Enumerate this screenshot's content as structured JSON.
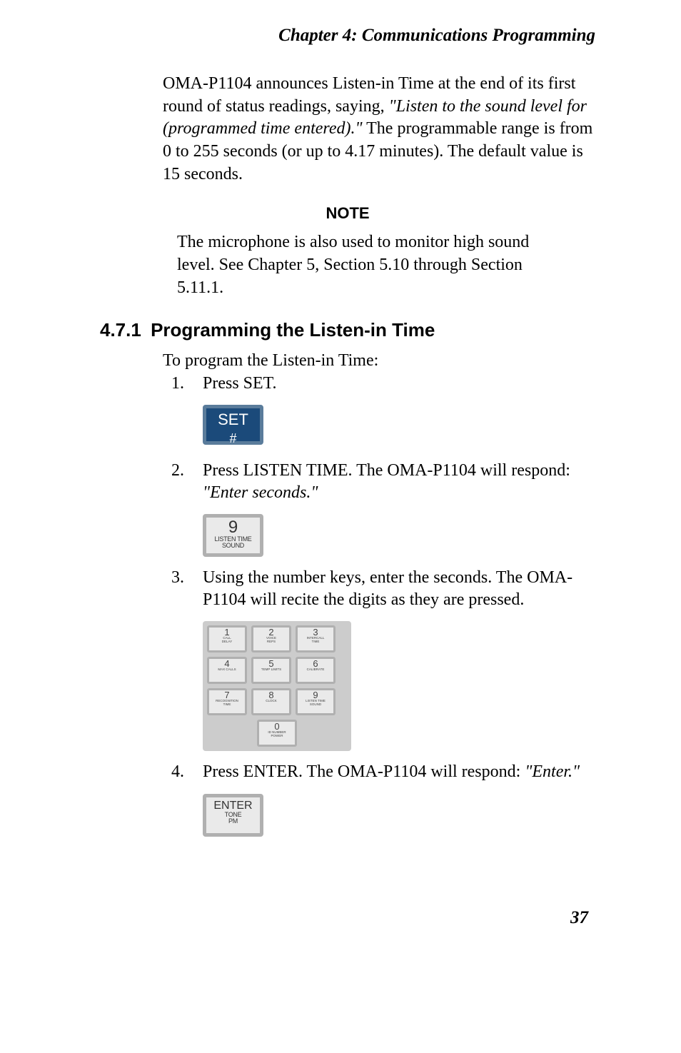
{
  "header": {
    "text": "Chapter 4: Communications Programming"
  },
  "intro_text": "OMA-P1104 announces Listen-in Time at the end of its first round of status readings, saying, ",
  "intro_quote": "\"Listen to the sound level for (programmed time entered).\"",
  "intro_rest": " The programmable range is from 0 to 255 seconds (or up to 4.17 minutes). The default value is 15 seconds.",
  "note": {
    "label": "NOTE",
    "text": "The microphone is also used to monitor high sound level. See Chapter 5, Section 5.10 through Section 5.11.1."
  },
  "section": {
    "num": "4.7.1",
    "title": "Programming the Listen-in Time"
  },
  "lead": "To program the Listen-in Time:",
  "steps": {
    "s1": {
      "text": "Press SET.",
      "key": {
        "line1": "SET",
        "line2": "#"
      }
    },
    "s2": {
      "text_before": "Press LISTEN TIME. The OMA-P1104 will respond: ",
      "quote": "\"Enter seconds.\"",
      "key": {
        "num": "9",
        "sub1": "LISTEN TIME",
        "sub2": "SOUND"
      }
    },
    "s3": {
      "text": "Using the number keys, enter the seconds. The OMA-P1104 will recite the digits as they are pressed.",
      "keypad": [
        {
          "n": "1",
          "s1": "CALL",
          "s2": "DELAY"
        },
        {
          "n": "2",
          "s1": "VOICE",
          "s2": "REPS"
        },
        {
          "n": "3",
          "s1": "INTERCALL",
          "s2": "TIME"
        },
        {
          "n": "4",
          "s1": "MAX CALLS",
          "s2": ""
        },
        {
          "n": "5",
          "s1": "TEMP LIMITS",
          "s2": ""
        },
        {
          "n": "6",
          "s1": "CALIBRATE",
          "s2": ""
        },
        {
          "n": "7",
          "s1": "RECOGNITION",
          "s2": "TIME"
        },
        {
          "n": "8",
          "s1": "CLOCK",
          "s2": ""
        },
        {
          "n": "9",
          "s1": "LISTEN TIME",
          "s2": "SOUND"
        },
        {
          "n": "0",
          "s1": "ID NUMBER",
          "s2": "POWER"
        }
      ]
    },
    "s4": {
      "text_before": "Press ENTER. The OMA-P1104 will respond: ",
      "quote": "\"Enter.\"",
      "key": {
        "line1": "ENTER",
        "sub1": "TONE",
        "sub2": "PM"
      }
    }
  },
  "page_number": "37"
}
